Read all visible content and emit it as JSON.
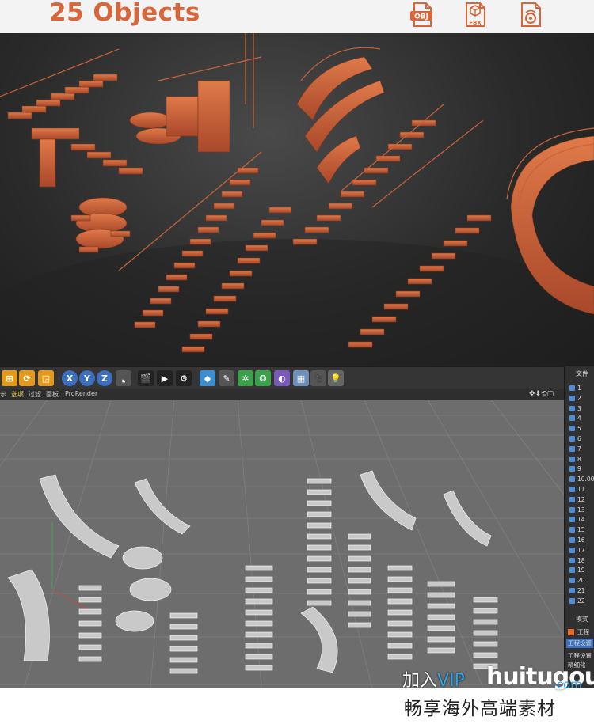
{
  "header": {
    "title": "25 Objects",
    "formats": [
      {
        "name": "obj-file-icon",
        "label": "OBJ"
      },
      {
        "name": "fbx-file-icon",
        "label": "FBX"
      },
      {
        "name": "c4d-file-icon",
        "label": ""
      }
    ],
    "accent_color": "#d9663a"
  },
  "toolbar": {
    "axis_x": "X",
    "axis_y": "Y",
    "axis_z": "Z"
  },
  "menubar": {
    "items": [
      "示",
      "选项",
      "过滤",
      "面板",
      "ProRender"
    ]
  },
  "right_panel": {
    "tab_label": "文件",
    "objects": [
      "1",
      "2",
      "3",
      "4",
      "5",
      "6",
      "7",
      "8",
      "9",
      "10.00",
      "11",
      "12",
      "13",
      "14",
      "15",
      "16",
      "17",
      "18",
      "19",
      "20",
      "21",
      "22"
    ],
    "mode_label": "模式",
    "sub_items": [
      "工程",
      "工程设置",
      "工程设置",
      "精细化"
    ]
  },
  "watermark": {
    "line1_prefix": "加入",
    "line1_vip": "VIP",
    "brand": "huitugou",
    "domain": ".com",
    "line2": "畅享海外高端素材"
  }
}
